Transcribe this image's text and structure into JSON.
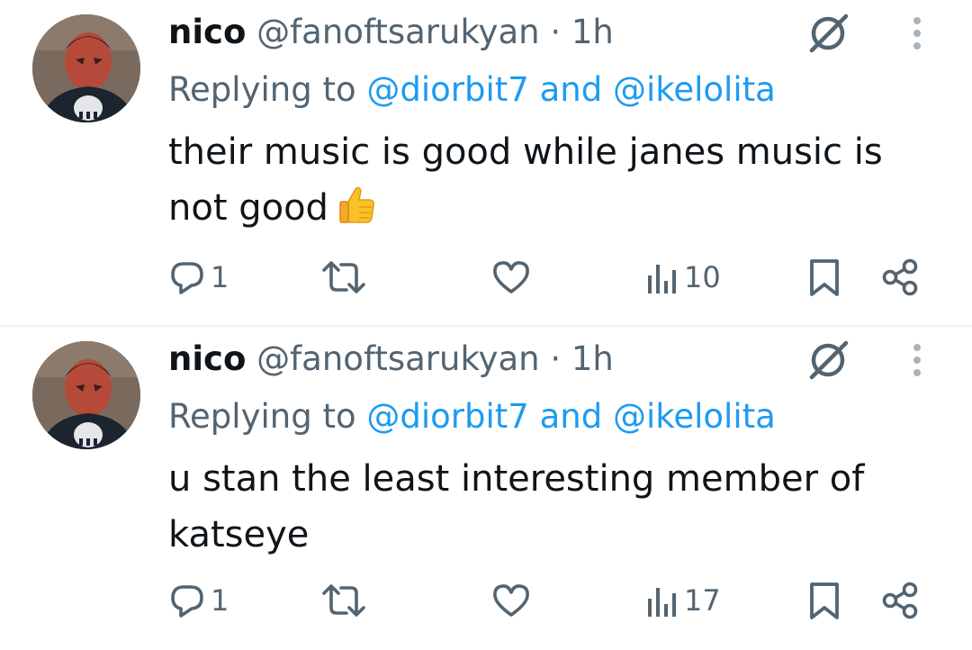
{
  "tweets": [
    {
      "name": "nico",
      "handle": "@fanoftsarukyan",
      "separator": "·",
      "time": "1h",
      "replying_prefix": "Replying to",
      "mention_1": "@diorbit7",
      "connector": "and",
      "mention_2": "@ikelolita",
      "text": "their music is good while janes music is not good",
      "emoji": "thumbs-up",
      "replies": "1",
      "reposts": "",
      "likes": "",
      "views": "10"
    },
    {
      "name": "nico",
      "handle": "@fanoftsarukyan",
      "separator": "·",
      "time": "1h",
      "replying_prefix": "Replying to",
      "mention_1": "@diorbit7",
      "connector": "and",
      "mention_2": "@ikelolita",
      "text": "u stan the least interesting member of katseye",
      "emoji": "",
      "replies": "1",
      "reposts": "",
      "likes": "",
      "views": "17"
    }
  ],
  "colors": {
    "text": "#0f1419",
    "secondary": "#536471",
    "link": "#1d9bf0",
    "divider": "#eff3f4"
  },
  "icons": [
    "avatar",
    "grok-icon",
    "more-icon",
    "reply-icon",
    "retweet-icon",
    "like-icon",
    "views-icon",
    "bookmark-icon",
    "share-icon",
    "thumbs-up-emoji"
  ]
}
